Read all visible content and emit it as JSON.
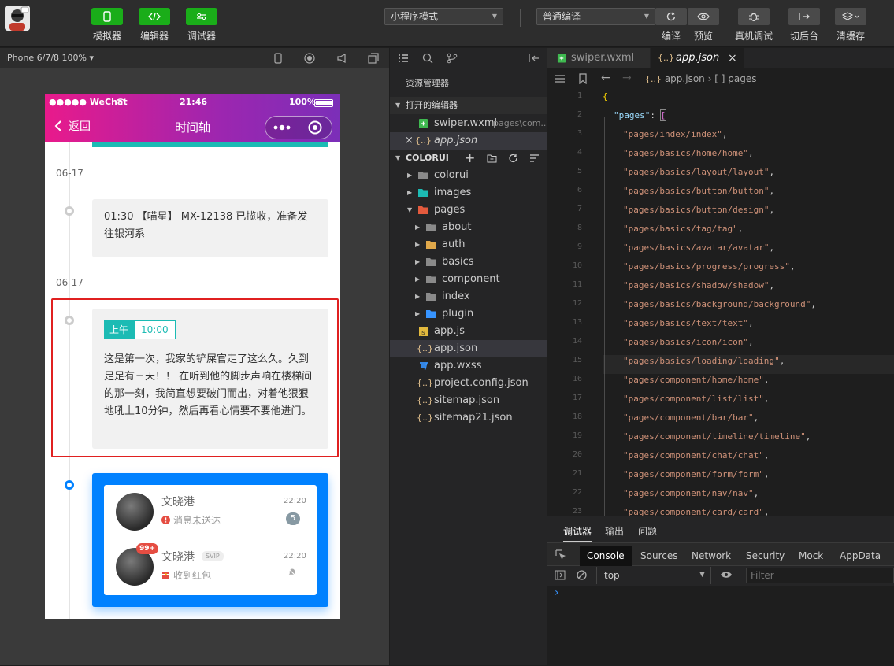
{
  "toolbar": {
    "simulator_label": "模拟器",
    "editor_label": "编辑器",
    "debugger_label": "调试器",
    "mode_select": "小程序模式",
    "compile_select": "普通编译",
    "compile_label": "编译",
    "preview_label": "预览",
    "realdevice_label": "真机调试",
    "background_label": "切后台",
    "clearcache_label": "清缓存"
  },
  "simulator": {
    "device": "iPhone 6/7/8 100% ▾",
    "statusbar": {
      "carrier": "●●●●● WeChat",
      "time": "21:46",
      "battery": "100%"
    },
    "nav": {
      "back_label": "返回",
      "title": "时间轴"
    },
    "timeline": {
      "date1": "06-17",
      "card1_text": "01:30 【喵星】 MX-12138 已揽收，准备发往银河系",
      "date2": "06-17",
      "tag_am": "上午",
      "tag_time": "10:00",
      "card2_text": "这是第一次，我家的铲屎官走了这么久。久到足足有三天！！ 在听到他的脚步声响在楼梯间的那一刻，我简直想要破门而出，对着他狠狠地吼上10分钟，然后再看心情要不要他进门。",
      "chats": [
        {
          "name": "文晓港",
          "time": "22:20",
          "status": "消息未送达",
          "badge": "5"
        },
        {
          "name": "文晓港",
          "vip": "SVIP",
          "time": "22:20",
          "status": "收到红包",
          "avatar_badge": "99+"
        }
      ]
    }
  },
  "explorer": {
    "title": "资源管理器",
    "open_editors_section": "打开的编辑器",
    "open_files": [
      {
        "name": "swiper.wxml",
        "path": "pages\\com..."
      },
      {
        "name": "app.json"
      }
    ],
    "project_section": "COLORUI",
    "tree": [
      {
        "name": "colorui"
      },
      {
        "name": "images"
      },
      {
        "name": "pages"
      },
      {
        "name": "about"
      },
      {
        "name": "auth"
      },
      {
        "name": "basics"
      },
      {
        "name": "component"
      },
      {
        "name": "index"
      },
      {
        "name": "plugin"
      },
      {
        "name": "app.js"
      },
      {
        "name": "app.json"
      },
      {
        "name": "app.wxss"
      },
      {
        "name": "project.config.json"
      },
      {
        "name": "sitemap.json"
      },
      {
        "name": "sitemap21.json"
      }
    ]
  },
  "editor": {
    "tabs": [
      "swiper.wxml",
      "app.json"
    ],
    "breadcrumb": {
      "file": "app.json",
      "sep": "›",
      "node": "[ ] pages"
    },
    "open_brace": "{",
    "pages_key": "\"pages\"",
    "pages": [
      "pages/index/index",
      "pages/basics/home/home",
      "pages/basics/layout/layout",
      "pages/basics/button/button",
      "pages/basics/button/design",
      "pages/basics/tag/tag",
      "pages/basics/avatar/avatar",
      "pages/basics/progress/progress",
      "pages/basics/shadow/shadow",
      "pages/basics/background/background",
      "pages/basics/text/text",
      "pages/basics/icon/icon",
      "pages/basics/loading/loading",
      "pages/component/home/home",
      "pages/component/list/list",
      "pages/component/bar/bar",
      "pages/component/timeline/timeline",
      "pages/component/chat/chat",
      "pages/component/form/form",
      "pages/component/nav/nav",
      "pages/component/card/card"
    ],
    "line_numbers": [
      "1",
      "2",
      "3",
      "4",
      "5",
      "6",
      "7",
      "8",
      "9",
      "10",
      "11",
      "12",
      "13",
      "14",
      "15",
      "16",
      "17",
      "18",
      "19",
      "20",
      "21",
      "22",
      "23"
    ]
  },
  "debugger": {
    "tabs": [
      "调试器",
      "输出",
      "问题"
    ],
    "console_tabs": [
      "Console",
      "Sources",
      "Network",
      "Security",
      "Mock",
      "AppData"
    ],
    "context": "top",
    "filter_placeholder": "Filter",
    "prompt": "›"
  },
  "colors": {
    "accent_green": "#1aad19",
    "timeline_blue": "#0081ff",
    "highlight_red": "#e02020"
  }
}
